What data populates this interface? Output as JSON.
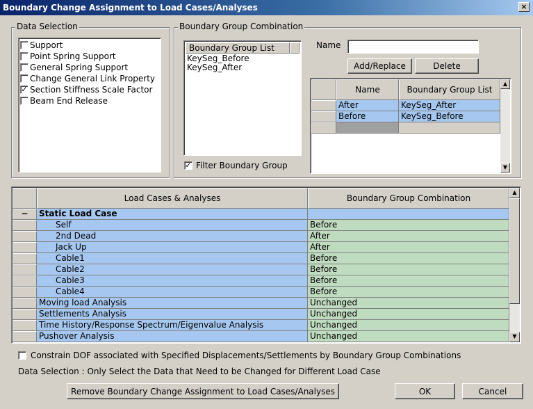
{
  "window": {
    "title": "Boundary Change Assignment to Load Cases/Analyses",
    "close_glyph": "×"
  },
  "data_selection": {
    "label": "Data Selection",
    "items": [
      {
        "label": "Support",
        "checked": false
      },
      {
        "label": "Point Spring Support",
        "checked": false
      },
      {
        "label": "General Spring Support",
        "checked": false
      },
      {
        "label": "Change General Link Property",
        "checked": false
      },
      {
        "label": "Section Stiffness Scale Factor",
        "checked": true
      },
      {
        "label": "Beam End Release",
        "checked": false
      }
    ]
  },
  "bgc": {
    "label": "Boundary Group Combination",
    "list_header": "Boundary Group List",
    "list_items": [
      "KeySeg_Before",
      "KeySeg_After"
    ],
    "filter_label": "Filter Boundary Group",
    "filter_checked": true,
    "name_label": "Name",
    "name_value": "",
    "add_replace_label": "Add/Replace",
    "delete_label": "Delete",
    "table": {
      "headers": [
        "Name",
        "Boundary Group List"
      ],
      "rows": [
        {
          "name": "After",
          "list": "KeySeg_After"
        },
        {
          "name": "Before",
          "list": "KeySeg_Before"
        }
      ]
    }
  },
  "main_table": {
    "headers": [
      "Load Cases & Analyses",
      "Boundary Group Combination"
    ],
    "group_toggle": "−",
    "group_title": "Static Load Case",
    "rows": [
      {
        "case": "Self",
        "combo": "Before",
        "indent": true
      },
      {
        "case": "2nd Dead",
        "combo": "After",
        "indent": true
      },
      {
        "case": "Jack Up",
        "combo": "After",
        "indent": true
      },
      {
        "case": "Cable1",
        "combo": "Before",
        "indent": true
      },
      {
        "case": "Cable2",
        "combo": "Before",
        "indent": true
      },
      {
        "case": "Cable3",
        "combo": "Before",
        "indent": true
      },
      {
        "case": "Cable4",
        "combo": "Before",
        "indent": true
      },
      {
        "case": "Moving load Analysis",
        "combo": "Unchanged",
        "indent": false
      },
      {
        "case": "Settlements Analysis",
        "combo": "Unchanged",
        "indent": false
      },
      {
        "case": "Time History/Response Spectrum/Eigenvalue Analysis",
        "combo": "Unchanged",
        "indent": false
      },
      {
        "case": "Pushover Analysis",
        "combo": "Unchanged",
        "indent": false
      }
    ]
  },
  "constrain": {
    "label": "Constrain DOF associated with Specified Displacements/Settlements by Boundary Group Combinations",
    "checked": false
  },
  "hint": "Data Selection : Only Select the Data that Need to be Changed for Different Load Case",
  "buttons": {
    "remove": "Remove Boundary Change Assignment to Load Cases/Analyses",
    "ok": "OK",
    "cancel": "Cancel"
  },
  "colors": {
    "selected_cell": "#a6c8f0",
    "combo_cell": "#c0dcc0",
    "title_bar": "#0a246a"
  },
  "icons": {
    "check": "✓",
    "scroll_up": "▲",
    "scroll_down": "▼"
  }
}
